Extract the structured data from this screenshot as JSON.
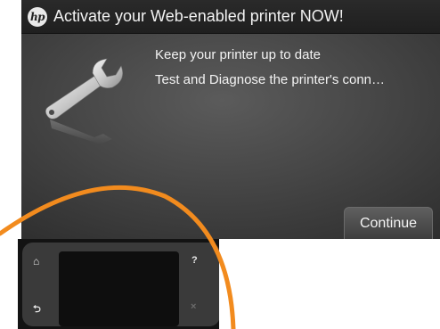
{
  "header": {
    "logo_text": "hp",
    "title": "Activate your Web-enabled printer NOW!"
  },
  "features": [
    "Keep your printer up to date",
    "Test and Diagnose the printer's conn…"
  ],
  "buttons": {
    "continue_label": "Continue"
  },
  "control_panel": {
    "home_icon": "⌂",
    "help_icon": "?",
    "back_icon": "⮌",
    "close_icon": "×"
  },
  "colors": {
    "accent_orange": "#f28b1e",
    "screen_bg": "#474747",
    "title_bar_bg": "#222222"
  },
  "icons": [
    "hp-logo",
    "wrench-icon",
    "home-icon",
    "help-icon",
    "back-icon",
    "close-icon"
  ]
}
